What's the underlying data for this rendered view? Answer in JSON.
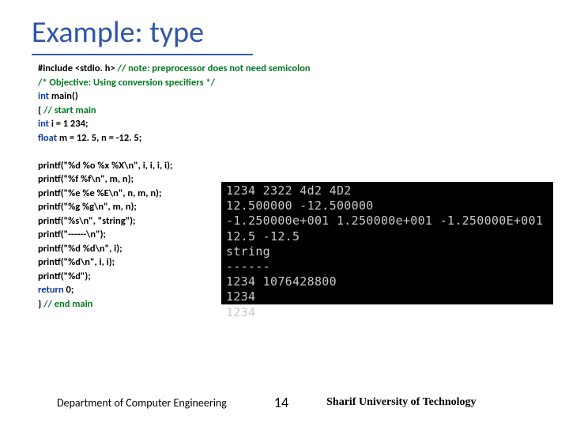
{
  "title": "Example: type",
  "code": {
    "l1a": "#include <stdio. h>  ",
    "l1b": "// note: preprocessor does not need semicolon",
    "l2": "/*   Objective: Using conversion specifiers */",
    "l3a": "int",
    "l3b": " main()",
    "l4a": "{ ",
    "l4b": "// start main",
    "l5a": "   int",
    "l5b": " i = 1 234;",
    "l6a": "   float",
    "l6b": " m = 12. 5, n = -12. 5;",
    "l7": "   printf(\"%d %o %x %X\\n\", i, i, i, i);",
    "l8": "   printf(\"%f %f\\n\", m, n);",
    "l9": "   printf(\"%e %e %E\\n\", n, m, n);",
    "l10": "   printf(\"%g %g\\n\", m, n);",
    "l11": "   printf(\"%s\\n\", \"string\");",
    "l12": "   printf(\"------\\n\");",
    "l13": "   printf(\"%d %d\\n\", i);",
    "l14": "   printf(\"%d\\n\", i, i);",
    "l15": "   printf(\"%d\");",
    "l16a": "  return",
    "l16b": " 0;",
    "l17a": "} ",
    "l17b": "// end main"
  },
  "console": "1234 2322 4d2 4D2\n12.500000 -12.500000\n-1.250000e+001 1.250000e+001 -1.250000E+001\n12.5 -12.5\nstring\n------\n1234 1076428800\n1234\n1234",
  "footer": {
    "dept": "Department of Computer Engineering",
    "page": "14",
    "uni": "Sharif University of Technology"
  }
}
